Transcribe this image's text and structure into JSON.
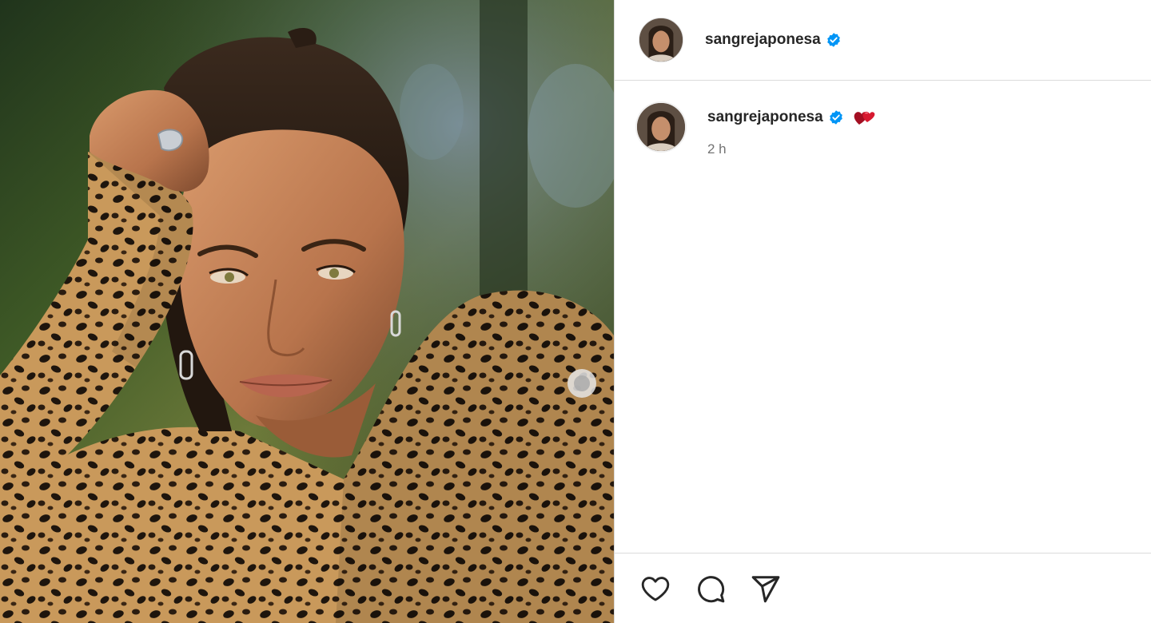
{
  "post": {
    "author": "sangrejaponesa",
    "verified": true,
    "caption_username": "sangrejaponesa",
    "caption_emoji": "two-hearts-emoji",
    "timestamp": "2 h"
  },
  "icons": {
    "like": "heart-outline-icon",
    "comment": "comment-bubble-icon",
    "share": "paper-plane-icon",
    "verified": "verified-badge-icon"
  },
  "colors": {
    "verified_blue": "#0095f6",
    "text_primary": "#262626",
    "text_secondary": "#737373",
    "divider": "#dbdbdb",
    "emoji_red": "#c8102e"
  }
}
